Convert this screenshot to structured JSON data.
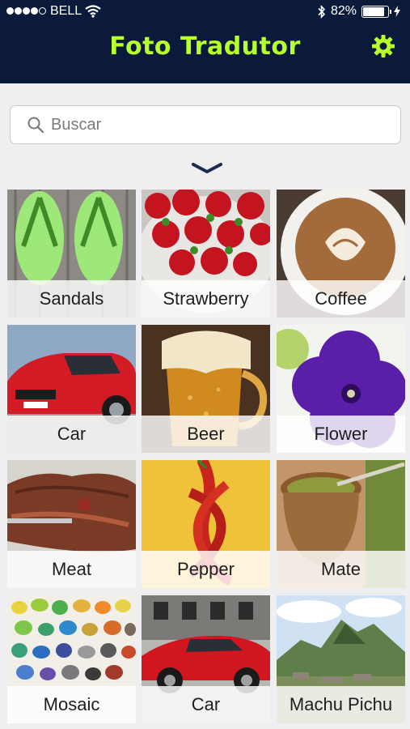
{
  "status_bar": {
    "carrier": "BELL",
    "battery_percent": "82%",
    "battery_level": 0.82,
    "signal_icon": "signal-dots-icon",
    "wifi_icon": "wifi-icon",
    "bluetooth_icon": "bluetooth-icon",
    "charging_icon": "charging-bolt-icon"
  },
  "header": {
    "title": "Foto Tradutor",
    "settings_icon": "gear-icon",
    "background_color": "#0b1a3a",
    "accent_color": "#b8ff2e"
  },
  "search": {
    "placeholder": "Buscar",
    "value": ""
  },
  "collapse_icon": "chevron-down-icon",
  "categories": [
    {
      "label": "Sandals"
    },
    {
      "label": "Strawberry"
    },
    {
      "label": "Coffee"
    },
    {
      "label": "Car"
    },
    {
      "label": "Beer"
    },
    {
      "label": "Flower"
    },
    {
      "label": "Meat"
    },
    {
      "label": "Pepper"
    },
    {
      "label": "Mate"
    },
    {
      "label": "Mosaic"
    },
    {
      "label": "Car"
    },
    {
      "label": "Machu Pichu"
    }
  ]
}
